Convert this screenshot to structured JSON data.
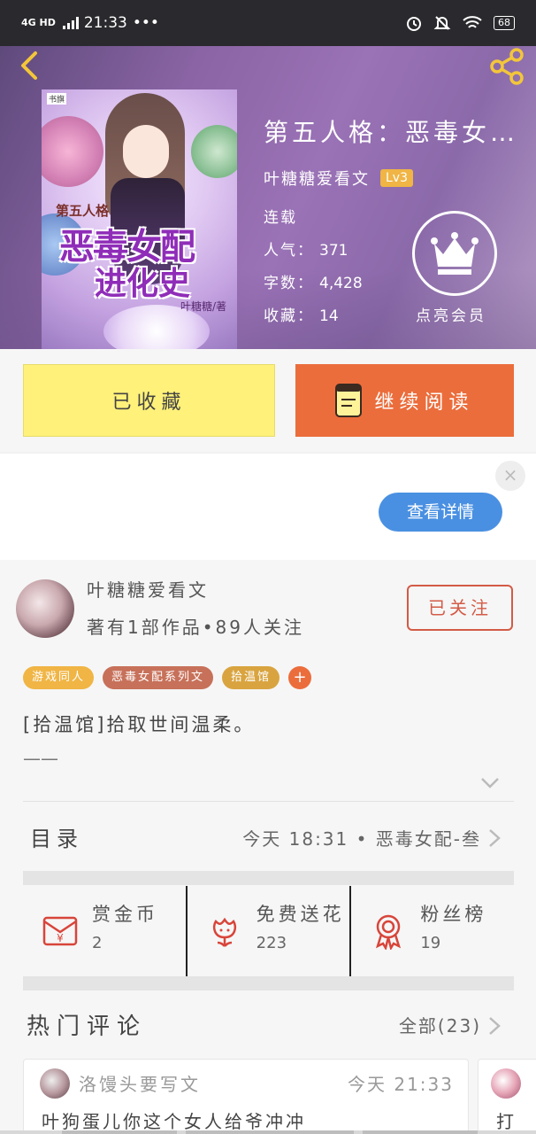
{
  "status_bar": {
    "network": "4G HD",
    "time": "21:33",
    "more": "•••",
    "battery": "68"
  },
  "header": {
    "cover": {
      "publisher_tag": "书旗",
      "series": "第五人格",
      "title_line1": "恶毒女配",
      "title_line2": "进化史",
      "author_credit": "叶糖糖/著"
    },
    "title": "第五人格：恶毒女…",
    "author": "叶糖糖爱看文",
    "level": "Lv3",
    "serial_status": "连载",
    "popularity_label": "人气：",
    "popularity": "371",
    "word_count_label": "字数：",
    "word_count": "4,428",
    "collections_label": "收藏：",
    "collections": "14",
    "vip_label": "点亮会员"
  },
  "actions": {
    "collected_label": "已收藏",
    "continue_label": "继续阅读"
  },
  "ad": {
    "close": "×",
    "detail_button": "查看详情"
  },
  "author_section": {
    "name": "叶糖糖爱看文",
    "meta": "著有1部作品•89人关注",
    "follow_label": "已关注",
    "tags": [
      "游戏同人",
      "恶毒女配系列文",
      "拾温馆"
    ],
    "tag_add": "+",
    "description": "[拾温馆]拾取世间温柔。",
    "description_more": "——…",
    "toc_label": "目录",
    "toc_latest": "今天 18:31 • 恶毒女配-叁",
    "stats": [
      {
        "label": "赏金币",
        "value": "2",
        "icon": "red-envelope-icon"
      },
      {
        "label": "免费送花",
        "value": "223",
        "icon": "flower-icon"
      },
      {
        "label": "粉丝榜",
        "value": "19",
        "icon": "medal-icon"
      }
    ],
    "hot_comments_title": "热门评论",
    "all_comments": "全部(23)"
  },
  "comments": [
    {
      "user": "洛馒头要写文",
      "time": "今天 21:33",
      "text": "叶狗蛋儿你这个女人给爷冲冲"
    },
    {
      "text": "打"
    }
  ],
  "colors": {
    "accent_orange": "#eb6d3c",
    "collected_yellow": "#fff17a",
    "level_badge": "#f0b545",
    "ad_button_blue": "#4a90e2",
    "follow_red": "#d35b46"
  }
}
